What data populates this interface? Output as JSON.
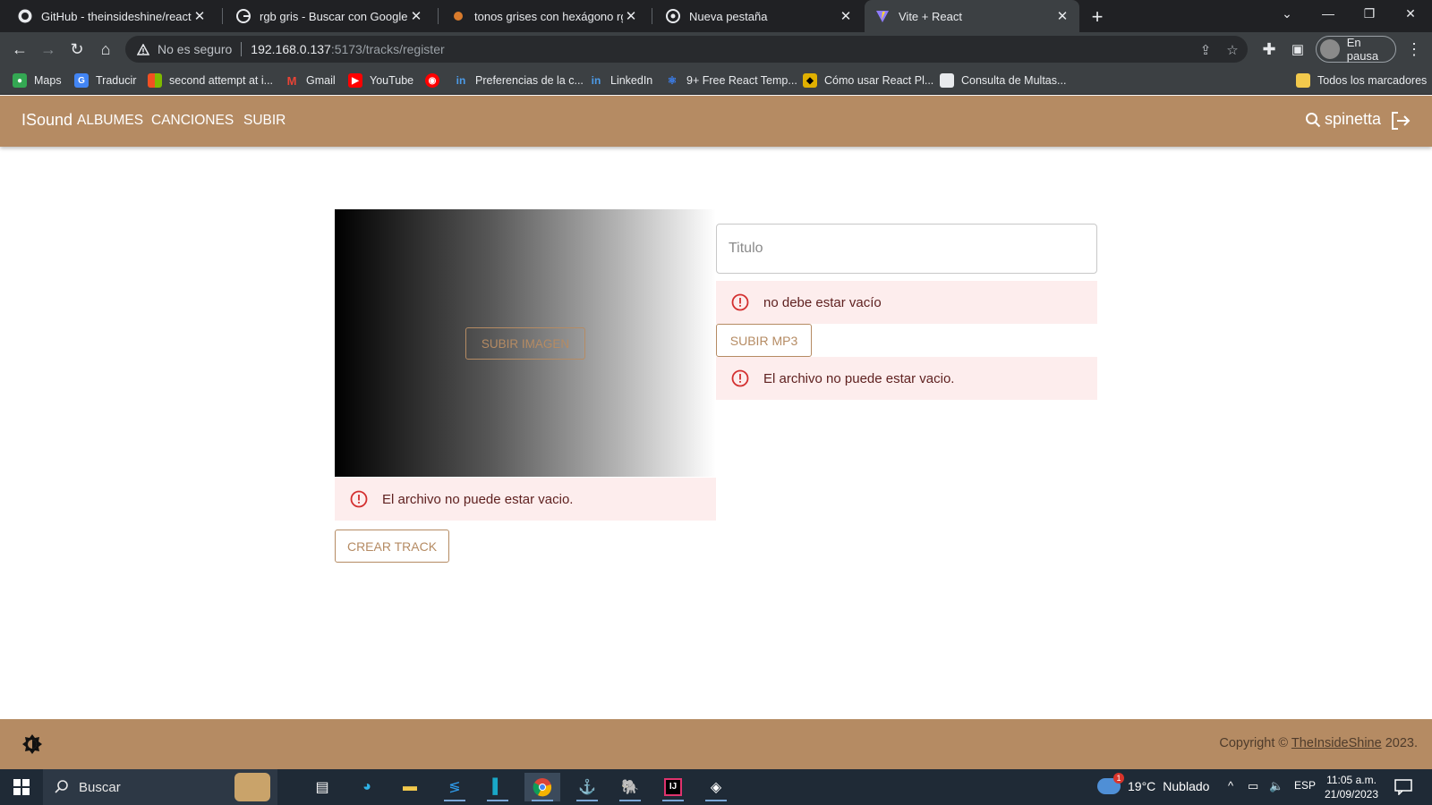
{
  "browser": {
    "tabs": [
      {
        "title": "GitHub - theinsideshine/react-ins",
        "favicon": "github-icon",
        "active": false
      },
      {
        "title": "rgb gris - Buscar con Google",
        "favicon": "google-icon",
        "active": false
      },
      {
        "title": "tonos grises con hexágono rgb p",
        "favicon": "site-icon",
        "active": false
      },
      {
        "title": "Nueva pestaña",
        "favicon": "chrome-icon",
        "active": false
      },
      {
        "title": "Vite + React",
        "favicon": "vite-icon",
        "active": true
      }
    ],
    "address": {
      "security_label": "No es seguro",
      "host": "192.168.0.137",
      "path": ":5173/tracks/register"
    },
    "profile_label": "En pausa",
    "bookmarks": [
      {
        "label": "Maps",
        "icon": "maps-icon",
        "color": "#34a853"
      },
      {
        "label": "Traducir",
        "icon": "translate-icon",
        "color": "#4285f4"
      },
      {
        "label": "second attempt at i...",
        "icon": "microsoft-icon",
        "color": "#f25022"
      },
      {
        "label": "Gmail",
        "icon": "gmail-icon",
        "color": "#ea4335"
      },
      {
        "label": "YouTube",
        "icon": "youtube-icon",
        "color": "#ff0000"
      },
      {
        "label": "",
        "icon": "youtube-music-icon",
        "color": "#ff0000"
      },
      {
        "label": "Preferencias de la c...",
        "icon": "linkedin-icon",
        "color": "#0a66c2"
      },
      {
        "label": "LinkedIn",
        "icon": "linkedin-icon",
        "color": "#0a66c2"
      },
      {
        "label": "9+ Free React Temp...",
        "icon": "react-icon",
        "color": "#3b82f6"
      },
      {
        "label": "Cómo usar React Pl...",
        "icon": "batman-icon",
        "color": "#e0b000"
      },
      {
        "label": "Consulta de Multas...",
        "icon": "document-icon",
        "color": "#e8eaed"
      }
    ],
    "all_bookmarks_label": "Todos los marcadores"
  },
  "app": {
    "brand": "ISound",
    "nav": [
      "ALBUMES",
      "CANCIONES",
      "SUBIR"
    ],
    "username": "spinetta",
    "accent_color": "#b58b63"
  },
  "form": {
    "upload_image_label": "SUBIR IMAGEN",
    "title_placeholder": "Titulo",
    "title_error": "no debe estar vacío",
    "upload_mp3_label": "SUBIR MP3",
    "mp3_error": "El archivo no puede estar vacio.",
    "image_error": "El archivo no puede estar vacio.",
    "submit_label": "CREAR TRACK"
  },
  "footer": {
    "copyright_prefix": "Copyright ©",
    "copyright_link": "TheInsideShine",
    "copyright_year": "2023."
  },
  "taskbar": {
    "search_label": "Buscar",
    "temperature": "19°C",
    "weather": "Nublado",
    "language": "ESP",
    "time": "11:05 a.m.",
    "date": "21/09/2023"
  }
}
